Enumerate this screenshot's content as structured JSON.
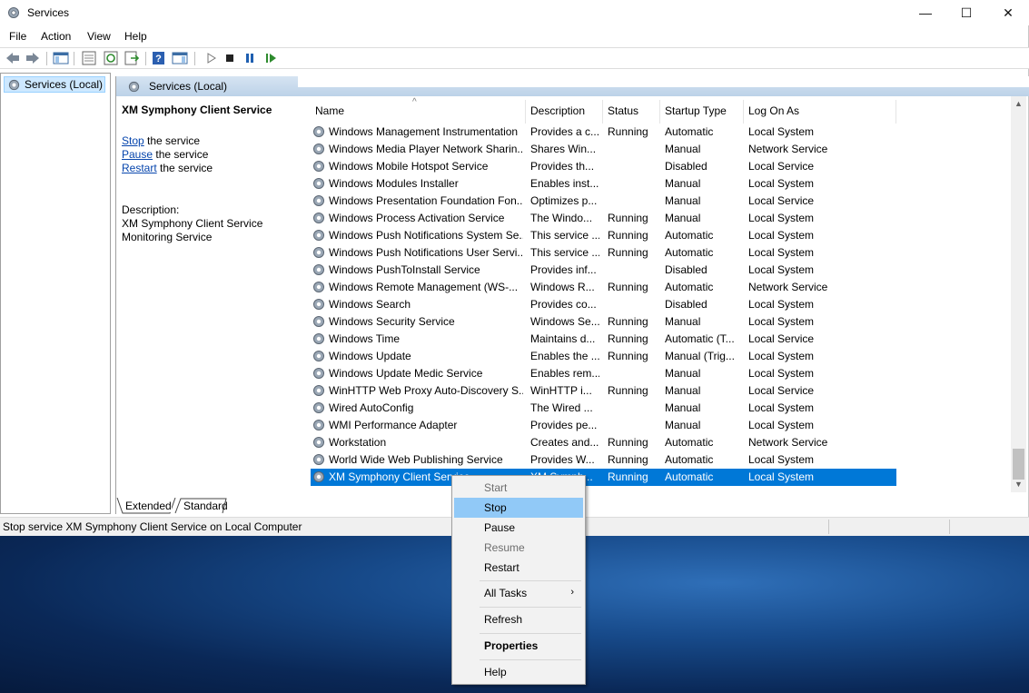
{
  "window": {
    "title": "Services",
    "minimize": "—",
    "maximize": "☐",
    "close": "✕"
  },
  "menu": [
    "File",
    "Action",
    "View",
    "Help"
  ],
  "tree": {
    "root_label": "Services (Local)"
  },
  "pane": {
    "header": "Services (Local)",
    "selected_service": "XM Symphony Client Service",
    "links": [
      {
        "link": "Stop",
        "rest": " the service"
      },
      {
        "link": "Pause",
        "rest": " the service"
      },
      {
        "link": "Restart",
        "rest": " the service"
      }
    ],
    "description_label": "Description:",
    "description_text": " XM Symphony Client Service Monitoring Service"
  },
  "columns": [
    "Name",
    "Description",
    "Status",
    "Startup Type",
    "Log On As"
  ],
  "rows": [
    [
      "Windows Management Instrumentation",
      "Provides a c...",
      "Running",
      "Automatic",
      "Local System"
    ],
    [
      "Windows Media Player Network Sharin...",
      "Shares Win...",
      "",
      "Manual",
      "Network Service"
    ],
    [
      "Windows Mobile Hotspot Service",
      "Provides th...",
      "",
      "Disabled",
      "Local Service"
    ],
    [
      "Windows Modules Installer",
      "Enables inst...",
      "",
      "Manual",
      "Local System"
    ],
    [
      "Windows Presentation Foundation Fon...",
      "Optimizes p...",
      "",
      "Manual",
      "Local Service"
    ],
    [
      "Windows Process Activation Service",
      "The Windo...",
      "Running",
      "Manual",
      "Local System"
    ],
    [
      "Windows Push Notifications System Se...",
      "This service ...",
      "Running",
      "Automatic",
      "Local System"
    ],
    [
      "Windows Push Notifications User Servi...",
      "This service ...",
      "Running",
      "Automatic",
      "Local System"
    ],
    [
      "Windows PushToInstall Service",
      "Provides inf...",
      "",
      "Disabled",
      "Local System"
    ],
    [
      "Windows Remote Management (WS-...",
      "Windows R...",
      "Running",
      "Automatic",
      "Network Service"
    ],
    [
      "Windows Search",
      "Provides co...",
      "",
      "Disabled",
      "Local System"
    ],
    [
      "Windows Security Service",
      "Windows Se...",
      "Running",
      "Manual",
      "Local System"
    ],
    [
      "Windows Time",
      "Maintains d...",
      "Running",
      "Automatic (T...",
      "Local Service"
    ],
    [
      "Windows Update",
      "Enables the ...",
      "Running",
      "Manual (Trig...",
      "Local System"
    ],
    [
      "Windows Update Medic Service",
      "Enables rem...",
      "",
      "Manual",
      "Local System"
    ],
    [
      "WinHTTP Web Proxy Auto-Discovery S...",
      "WinHTTP i...",
      "Running",
      "Manual",
      "Local Service"
    ],
    [
      "Wired AutoConfig",
      "The Wired ...",
      "",
      "Manual",
      "Local System"
    ],
    [
      "WMI Performance Adapter",
      "Provides pe...",
      "",
      "Manual",
      "Local System"
    ],
    [
      "Workstation",
      "Creates and...",
      "Running",
      "Automatic",
      "Network Service"
    ],
    [
      "World Wide Web Publishing Service",
      "Provides W...",
      "Running",
      "Automatic",
      "Local System"
    ],
    [
      "XM Symphony Client Service",
      "XM Symph...",
      "Running",
      "Automatic",
      "Local System"
    ]
  ],
  "tabs": [
    "Extended",
    "Standard"
  ],
  "status": "Stop service XM Symphony Client Service on Local Computer",
  "context_menu": {
    "items": [
      "Start",
      "Stop",
      "Pause",
      "Resume",
      "Restart",
      "All Tasks",
      "Refresh",
      "Properties",
      "Help"
    ],
    "submenu_arrow": "›"
  },
  "colors": {
    "selection": "#0078d7",
    "menu_hover": "#91c9f7",
    "link": "#0645ad"
  }
}
